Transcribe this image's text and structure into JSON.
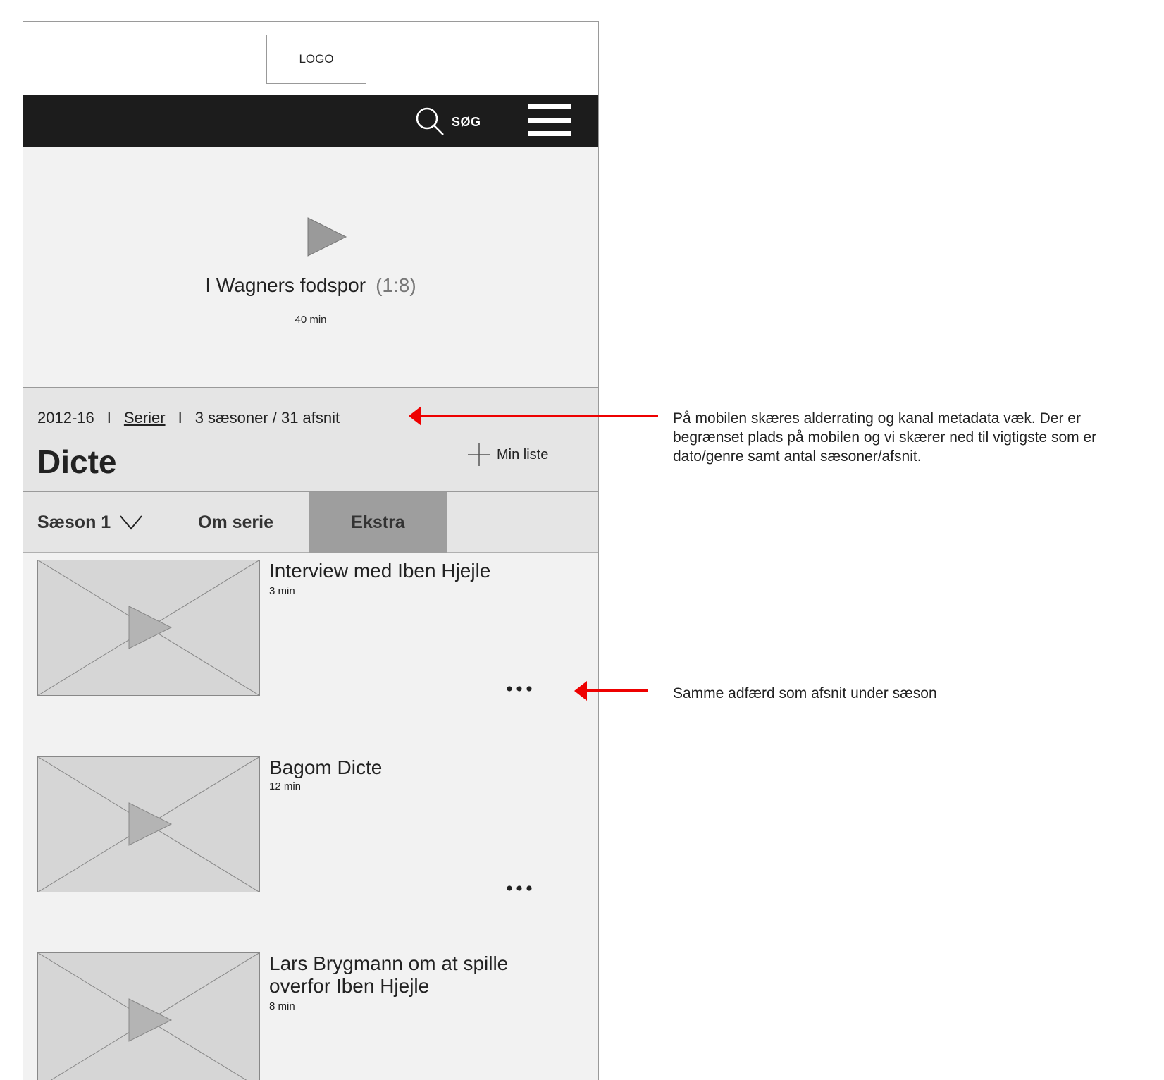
{
  "header": {
    "logo_label": "LOGO"
  },
  "nav": {
    "search_label": "SØG",
    "search_icon": "search-icon",
    "menu_icon": "hamburger-menu-icon"
  },
  "hero": {
    "title": "I Wagners fodspor",
    "episode": "(1:8)",
    "duration": "40 min"
  },
  "series": {
    "years": "2012-16",
    "separator": "I",
    "genre": "Serier",
    "seasons_info": "3 sæsoner / 31 afsnit",
    "title": "Dicte",
    "my_list_label": "Min liste"
  },
  "tabs": {
    "season": "Sæson 1",
    "about": "Om serie",
    "extra": "Ekstra"
  },
  "items": [
    {
      "title": "Interview med Iben Hjejle",
      "duration": "3 min"
    },
    {
      "title": "Bagom Dicte",
      "duration": "12 min"
    },
    {
      "title": "Lars Brygmann om at spille overfor Iben Hjejle",
      "duration": "8 min"
    }
  ],
  "annotations": {
    "meta_note": "På mobilen skæres alderrating og kanal metadata væk. Der er begrænset plads på mobilen og vi skærer ned til vigtigste som er dato/genre samt antal sæsoner/afsnit.",
    "items_note": "Samme adfærd som afsnit under sæson"
  },
  "colors": {
    "nav_bg": "#1c1c1c",
    "annotation_arrow": "#ee0000",
    "active_tab": "#9e9e9e"
  }
}
